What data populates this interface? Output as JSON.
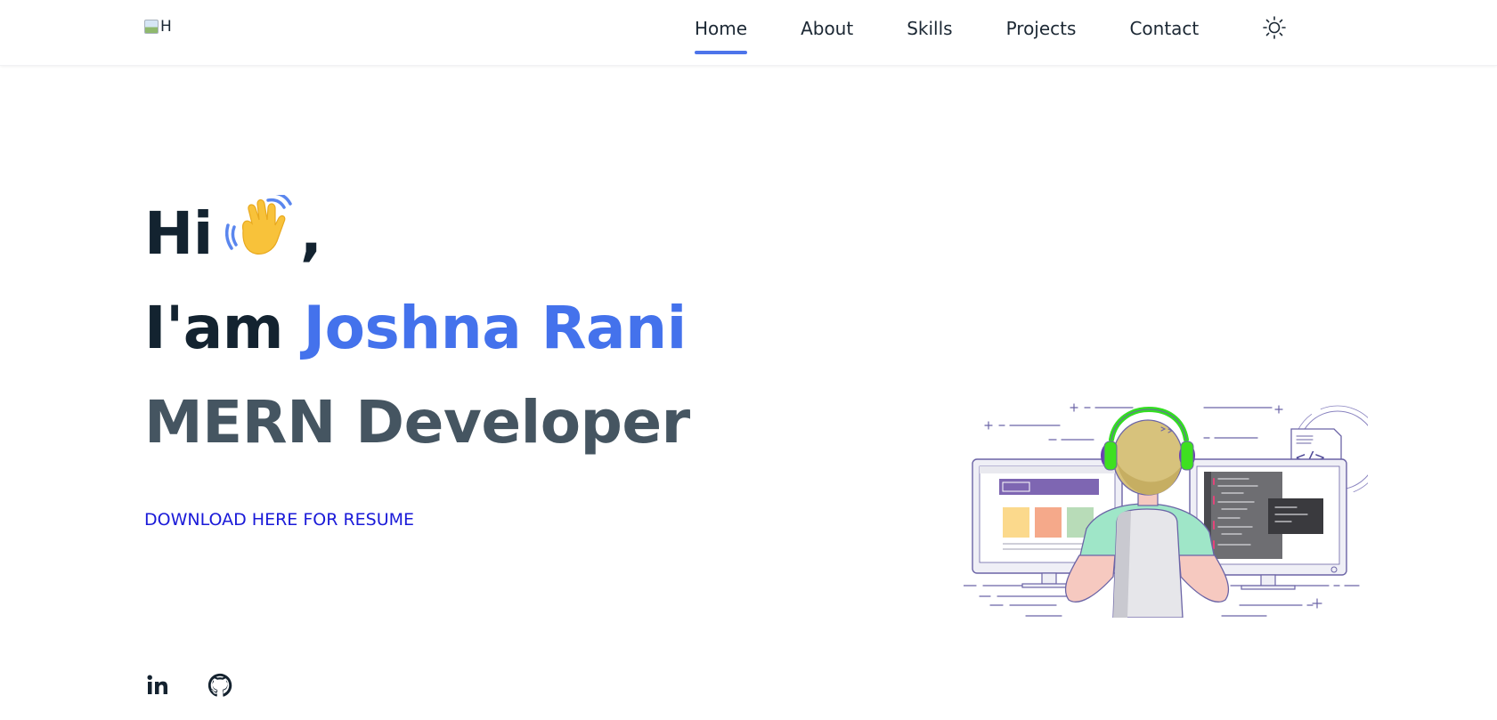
{
  "header": {
    "logo_alt": "H",
    "nav": [
      {
        "label": "Home",
        "active": true
      },
      {
        "label": "About",
        "active": false
      },
      {
        "label": "Skills",
        "active": false
      },
      {
        "label": "Projects",
        "active": false
      },
      {
        "label": "Contact",
        "active": false
      }
    ],
    "theme_toggle_icon": "sun-icon"
  },
  "hero": {
    "greeting": "Hi",
    "greeting_suffix": ",",
    "wave_icon": "waving-hand-icon",
    "intro_prefix": "I'am",
    "name": "Joshna Rani",
    "role": "MERN Developer",
    "resume_link": "DOWNLOAD HERE FOR RESUME"
  },
  "social": [
    {
      "icon": "linkedin-icon"
    },
    {
      "icon": "github-icon"
    }
  ],
  "colors": {
    "accent": "#4472ec",
    "nav_underline": "#4d74ea",
    "heading": "#132330",
    "role": "#455561",
    "link": "#1a1ad8"
  }
}
